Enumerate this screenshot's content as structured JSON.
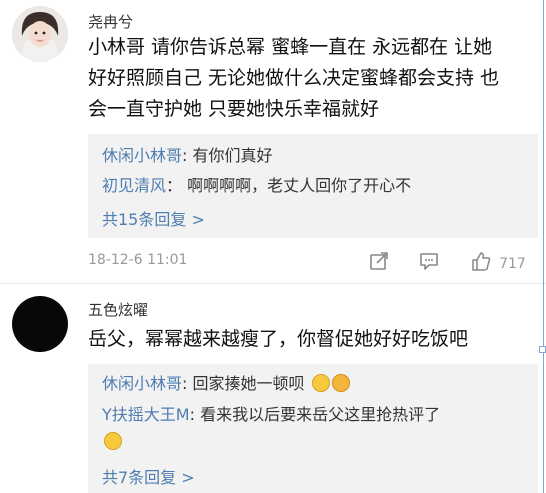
{
  "comments": [
    {
      "username": "尧冉兮",
      "body_lines": [
        "小林哥 请你告诉总幂 蜜蜂一直在 永远都在 让她",
        "好好照顾自己 无论她做什么决定蜜蜂都会支持 也",
        "会一直守护她 只要她快乐幸福就好"
      ],
      "replies": [
        {
          "author": "休闲小林哥",
          "sep": ": ",
          "text": "有你们真好"
        },
        {
          "author": "初见清风",
          "sep": "： ",
          "text": "啊啊啊啊，老丈人回你了开心不"
        }
      ],
      "more_replies": "共15条回复 >",
      "timestamp": "18-12-6 11:01",
      "like_count": "717",
      "icons": [
        "share-icon",
        "comment-icon",
        "like-icon"
      ]
    },
    {
      "username": "五色炫曜",
      "body_lines": [
        "岳父，幂幂越来越瘦了，你督促她好好吃饭吧"
      ],
      "replies": [
        {
          "author": "休闲小林哥",
          "sep": ": ",
          "text": "回家揍她一顿呗"
        },
        {
          "author": "Y扶摇大王M",
          "sep": ": ",
          "text": "看来我以后要来岳父这里抢热评了"
        }
      ],
      "more_replies": "共7条回复 >",
      "emoji": [
        "smile-emoji",
        "thinking-emoji",
        "laughing-tears-emoji"
      ]
    }
  ],
  "colors": {
    "link": "#4f7db0",
    "reply_bg": "#f2f2f2",
    "meta": "#999999"
  }
}
